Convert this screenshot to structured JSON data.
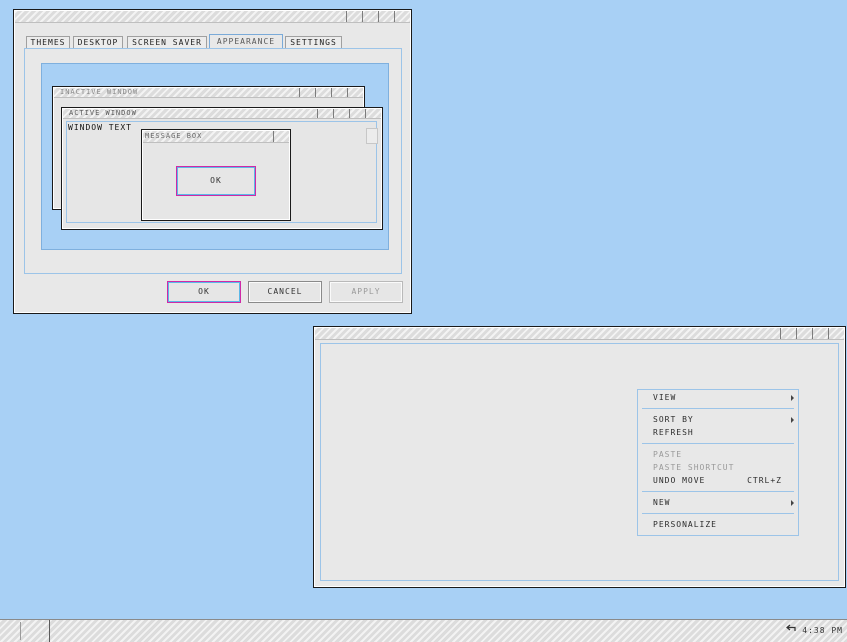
{
  "dialog": {
    "tabs": [
      {
        "label": "Themes"
      },
      {
        "label": "Desktop"
      },
      {
        "label": "Screen Saver"
      },
      {
        "label": "Appearance",
        "active": true
      },
      {
        "label": "Settings"
      }
    ],
    "preview": {
      "inactive_window_title": "Inactive Window",
      "active_window_title": "Active Window",
      "window_text": "Window Text",
      "message_box_title": "Message Box",
      "message_box_ok": "OK"
    },
    "buttons": {
      "ok": "OK",
      "cancel": "Cancel",
      "apply": "Apply"
    }
  },
  "context_menu": {
    "items": [
      {
        "label": "View",
        "submenu": true
      },
      {
        "label": "Sort By",
        "submenu": true
      },
      {
        "label": "Refresh"
      },
      {
        "label": "Paste",
        "disabled": true
      },
      {
        "label": "Paste Shortcut",
        "disabled": true
      },
      {
        "label": "Undo Move",
        "shortcut": "Ctrl+Z"
      },
      {
        "label": "New",
        "submenu": true
      },
      {
        "label": "Personalize"
      }
    ]
  },
  "taskbar": {
    "clock": "4:38 PM",
    "tray_icon": "back-arrow-icon"
  },
  "colors": {
    "desktop": "#a8d0f5",
    "accent_border": "#9cc4e8",
    "focus": "#d02aa6"
  }
}
